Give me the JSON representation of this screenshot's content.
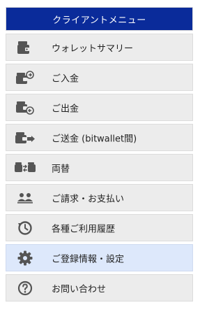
{
  "menu": {
    "header": "クライアントメニュー",
    "items": [
      {
        "label": "ウォレットサマリー",
        "icon": "wallet-icon"
      },
      {
        "label": "ご入金",
        "icon": "wallet-deposit-icon"
      },
      {
        "label": "ご出金",
        "icon": "wallet-withdraw-icon"
      },
      {
        "label": "ご送金 (bitwallet間)",
        "icon": "wallet-transfer-icon"
      },
      {
        "label": "両替",
        "icon": "currency-exchange-icon"
      },
      {
        "label": "ご請求・お支払い",
        "icon": "users-icon"
      },
      {
        "label": "各種ご利用履歴",
        "icon": "history-icon"
      },
      {
        "label": "ご登録情報・設定",
        "icon": "gear-icon"
      },
      {
        "label": "お問い合わせ",
        "icon": "question-icon"
      }
    ]
  },
  "colors": {
    "header_bg": "#0a2b9a",
    "item_bg": "#ececec",
    "active_bg": "#dde8fb",
    "icon": "#555555"
  }
}
